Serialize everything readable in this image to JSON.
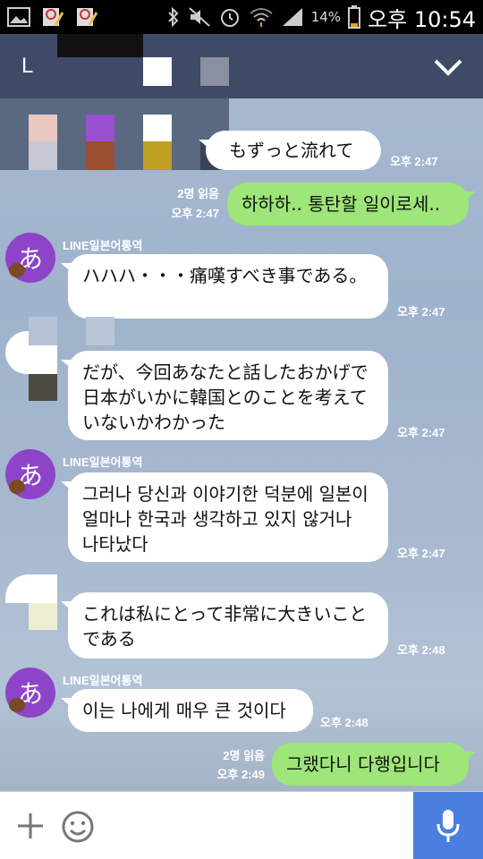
{
  "status_bar": {
    "battery": "14%",
    "time": "오후 10:54"
  },
  "header": {
    "title": "L"
  },
  "messages": [
    {
      "type": "in",
      "text": "もずっと流れて",
      "time": "오후 2:47"
    },
    {
      "type": "out",
      "text": "하하하.. 통탄할 일이로세..",
      "read": "2명 읽음",
      "time": "오후 2:47"
    },
    {
      "type": "in",
      "sender": "LINE일본어통역",
      "avatar": "あ",
      "text": "ハハハ・・・痛嘆すべき事である。",
      "time": "오후 2:47"
    },
    {
      "type": "in",
      "text": "だが、今回あなたと話したおかげで日本がいかに韓国とのことを考えていないかわかった",
      "time": "오후 2:47"
    },
    {
      "type": "in",
      "sender": "LINE일본어통역",
      "avatar": "あ",
      "text": "그러나 당신과 이야기한 덕분에 일본이 얼마나 한국과 생각하고 있지 않거나 나타났다",
      "time": "오후 2:47"
    },
    {
      "type": "in",
      "text": "これは私にとって非常に大きいことである",
      "time": "오후 2:48"
    },
    {
      "type": "in",
      "sender": "LINE일본어통역",
      "avatar": "あ",
      "text": "이는 나에게 매우 큰 것이다",
      "time": "오후 2:48"
    },
    {
      "type": "out",
      "text": "그랬다니 다행입니다",
      "read": "2명 읽음",
      "time": "오후 2:49"
    }
  ],
  "colors": {
    "header": "#3e4a66",
    "bubble_out": "#9ee57a",
    "avatar": "#8e44c8",
    "mic_button": "#4a7fe0"
  }
}
